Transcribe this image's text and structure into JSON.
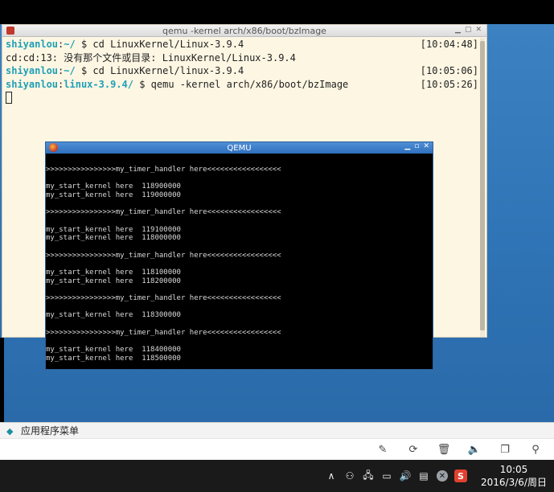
{
  "terminal": {
    "title": "qemu -kernel arch/x86/boot/bzImage",
    "lines": [
      {
        "user": "shiyanlou",
        "sep": ":",
        "path": "~/",
        "cmd": " $ cd LinuxKernel/Linux-3.9.4",
        "time": "[10:04:48]"
      },
      {
        "text": "cd:cd:13: 没有那个文件或目录: LinuxKernel/Linux-3.9.4"
      },
      {
        "user": "shiyanlou",
        "sep": ":",
        "path": "~/",
        "cmd": " $ cd LinuxKernel/linux-3.9.4",
        "time": "[10:05:06]"
      },
      {
        "user": "shiyanlou",
        "sep": ":",
        "path": "linux-3.9.4/",
        "cmd": " $ qemu -kernel arch/x86/boot/bzImage",
        "time": "[10:05:26]"
      }
    ]
  },
  "qemu": {
    "title": "QEMU",
    "lines": [
      "",
      ">>>>>>>>>>>>>>>>my_timer_handler here<<<<<<<<<<<<<<<<<",
      "",
      "my_start_kernel here  118900000",
      "my_start_kernel here  119000000",
      "",
      ">>>>>>>>>>>>>>>>my_timer_handler here<<<<<<<<<<<<<<<<<",
      "",
      "my_start_kernel here  119100000",
      "my_start_kernel here  118000000",
      "",
      ">>>>>>>>>>>>>>>>my_timer_handler here<<<<<<<<<<<<<<<<<",
      "",
      "my_start_kernel here  118100000",
      "my_start_kernel here  118200000",
      "",
      ">>>>>>>>>>>>>>>>my_timer_handler here<<<<<<<<<<<<<<<<<",
      "",
      "my_start_kernel here  118300000",
      "",
      ">>>>>>>>>>>>>>>>my_timer_handler here<<<<<<<<<<<<<<<<<",
      "",
      "my_start_kernel here  118400000",
      "my_start_kernel here  118500000"
    ]
  },
  "panel": {
    "menu_label": "应用程序菜单"
  },
  "toolbar": {
    "buttons": [
      "pin-icon",
      "refresh-icon",
      "trash-icon",
      "speaker-icon",
      "window-icon",
      "search-icon"
    ]
  },
  "taskbar": {
    "time": "10:05",
    "date": "2016/3/6/周日",
    "sogou_label": "S"
  },
  "colors": {
    "desktop": "#3c82c2",
    "terminal_bg": "#fdf6e3",
    "prompt": "#1fa0b5",
    "qemu_titlebar": "#2f6fbd",
    "taskbar": "#1a1a1a"
  }
}
